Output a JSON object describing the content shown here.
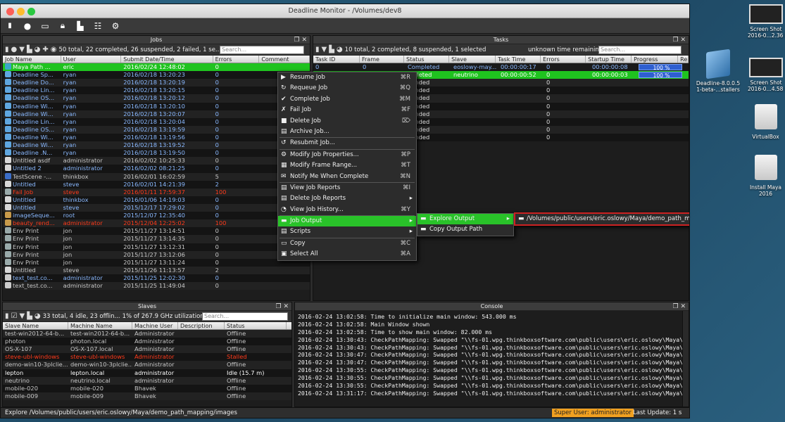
{
  "window": {
    "title": "Deadline Monitor - /Volumes/dev8"
  },
  "jobs_panel": {
    "title": "Jobs",
    "summary": "50 total, 22 completed, 26 suspended, 2 failed, 1 se...",
    "search_placeholder": "Search...",
    "columns": [
      "Job Name",
      "User",
      "Submit Date/Time",
      "Errors",
      "Comment"
    ],
    "rows": [
      {
        "name": "Maya Path ...",
        "user": "eric",
        "date": "2016/02/24 12:48:02",
        "errors": "0",
        "style": "sel",
        "icon": "maya-icon"
      },
      {
        "name": "Deadline Sp...",
        "user": "ryan",
        "date": "2016/02/18 13:20:23",
        "errors": "0",
        "style": "blue",
        "icon": "deadline-icon"
      },
      {
        "name": "Deadline Do...",
        "user": "ryan",
        "date": "2016/02/18 13:20:19",
        "errors": "0",
        "style": "blue",
        "icon": "deadline-icon"
      },
      {
        "name": "Deadline Lin...",
        "user": "ryan",
        "date": "2016/02/18 13:20:15",
        "errors": "0",
        "style": "blue",
        "icon": "deadline-icon"
      },
      {
        "name": "Deadline OS...",
        "user": "ryan",
        "date": "2016/02/18 13:20:12",
        "errors": "0",
        "style": "blue",
        "icon": "deadline-icon"
      },
      {
        "name": "Deadline Wi...",
        "user": "ryan",
        "date": "2016/02/18 13:20:10",
        "errors": "0",
        "style": "blue",
        "icon": "deadline-icon"
      },
      {
        "name": "Deadline Wi...",
        "user": "ryan",
        "date": "2016/02/18 13:20:07",
        "errors": "0",
        "style": "blue",
        "icon": "deadline-icon"
      },
      {
        "name": "Deadline Lin...",
        "user": "ryan",
        "date": "2016/02/18 13:20:04",
        "errors": "0",
        "style": "blue",
        "icon": "deadline-icon"
      },
      {
        "name": "Deadline OS...",
        "user": "ryan",
        "date": "2016/02/18 13:19:59",
        "errors": "0",
        "style": "blue",
        "icon": "deadline-icon"
      },
      {
        "name": "Deadline Wi...",
        "user": "ryan",
        "date": "2016/02/18 13:19:56",
        "errors": "0",
        "style": "blue",
        "icon": "deadline-icon"
      },
      {
        "name": "Deadline Wi...",
        "user": "ryan",
        "date": "2016/02/18 13:19:52",
        "errors": "0",
        "style": "blue",
        "icon": "deadline-icon"
      },
      {
        "name": "Deadline .N...",
        "user": "ryan",
        "date": "2016/02/18 13:19:50",
        "errors": "0",
        "style": "blue",
        "icon": "deadline-icon"
      },
      {
        "name": "Untitled asdf",
        "user": "administrator",
        "date": "2016/02/02 10:25:33",
        "errors": "0",
        "style": "gray",
        "icon": "window-icon"
      },
      {
        "name": "Untitled 2",
        "user": "administrator",
        "date": "2016/02/02 08:21:25",
        "errors": "0",
        "style": "blue",
        "icon": "window-icon"
      },
      {
        "name": "TestScene -...",
        "user": "thinkbox",
        "date": "2016/02/01 16:02:59",
        "errors": "5",
        "style": "gray",
        "icon": "3dsmax-icon"
      },
      {
        "name": "Untitled",
        "user": "steve",
        "date": "2016/02/01 14:21:39",
        "errors": "2",
        "style": "blue",
        "icon": "window-icon"
      },
      {
        "name": "Fail Job",
        "user": "steve",
        "date": "2016/01/11 17:59:37",
        "errors": "100",
        "style": "red",
        "icon": "script-icon"
      },
      {
        "name": "Untitled",
        "user": "thinkbox",
        "date": "2016/01/06 14:19:03",
        "errors": "0",
        "style": "blue",
        "icon": "window-icon"
      },
      {
        "name": "Untitled",
        "user": "steve",
        "date": "2015/12/17 17:29:02",
        "errors": "0",
        "style": "blue",
        "icon": "window-icon"
      },
      {
        "name": "imageSeque...",
        "user": "root",
        "date": "2015/12/07 12:35:40",
        "errors": "0",
        "style": "blue",
        "icon": "image-icon"
      },
      {
        "name": "beauty_rend...",
        "user": "administrator",
        "date": "2015/12/04 12:25:02",
        "errors": "100",
        "style": "red",
        "icon": "image-icon"
      },
      {
        "name": "Env Print",
        "user": "jon",
        "date": "2015/11/27 13:14:51",
        "errors": "0",
        "style": "gray",
        "icon": "script-icon"
      },
      {
        "name": "Env Print",
        "user": "jon",
        "date": "2015/11/27 13:14:35",
        "errors": "0",
        "style": "gray",
        "icon": "script-icon"
      },
      {
        "name": "Env Print",
        "user": "jon",
        "date": "2015/11/27 13:12:31",
        "errors": "0",
        "style": "gray",
        "icon": "script-icon"
      },
      {
        "name": "Env Print",
        "user": "jon",
        "date": "2015/11/27 13:12:06",
        "errors": "0",
        "style": "gray",
        "icon": "script-icon"
      },
      {
        "name": "Env Print",
        "user": "jon",
        "date": "2015/11/27 13:11:24",
        "errors": "0",
        "style": "gray",
        "icon": "script-icon"
      },
      {
        "name": "Untitled",
        "user": "steve",
        "date": "2015/11/26 11:13:57",
        "errors": "2",
        "style": "gray",
        "icon": "window-icon"
      },
      {
        "name": "text_test.co...",
        "user": "administrator",
        "date": "2015/11/25 12:02:30",
        "errors": "0",
        "style": "blue",
        "icon": "f-icon"
      },
      {
        "name": "text_test.co...",
        "user": "administrator",
        "date": "2015/11/25 11:49:04",
        "errors": "0",
        "style": "gray",
        "icon": "f-icon"
      }
    ]
  },
  "tasks_panel": {
    "title": "Tasks",
    "summary": "10 total, 2 completed, 8 suspended, 1 selected",
    "time_remaining": "unknown time remaining",
    "search_placeholder": "Search...",
    "columns": [
      "Task ID",
      "Frame",
      "Status",
      "Slave",
      "Task Time",
      "Errors",
      "Startup Time",
      "Progress",
      "Re"
    ],
    "rows": [
      {
        "id": "0",
        "frame": "0",
        "status": "Completed",
        "slave": "eoslowy-may...",
        "time": "00:00:00:17",
        "errors": "0",
        "startup": "00:00:00:08",
        "progress": "100 %",
        "style": "selblue"
      },
      {
        "id": "",
        "frame": "",
        "status": "mpleted",
        "slave": "neutrino",
        "time": "00:00:00:52",
        "errors": "0",
        "startup": "00:00:00:03",
        "progress": "100 %",
        "style": "sel"
      },
      {
        "id": "",
        "frame": "",
        "status": "pended",
        "slave": "",
        "time": "",
        "errors": "0",
        "startup": "",
        "progress": ""
      },
      {
        "id": "",
        "frame": "",
        "status": "pended",
        "slave": "",
        "time": "",
        "errors": "0",
        "startup": "",
        "progress": ""
      },
      {
        "id": "",
        "frame": "",
        "status": "pended",
        "slave": "",
        "time": "",
        "errors": "0",
        "startup": "",
        "progress": ""
      },
      {
        "id": "",
        "frame": "",
        "status": "pended",
        "slave": "",
        "time": "",
        "errors": "0",
        "startup": "",
        "progress": ""
      },
      {
        "id": "",
        "frame": "",
        "status": "pended",
        "slave": "",
        "time": "",
        "errors": "0",
        "startup": "",
        "progress": ""
      },
      {
        "id": "",
        "frame": "",
        "status": "pended",
        "slave": "",
        "time": "",
        "errors": "0",
        "startup": "",
        "progress": ""
      },
      {
        "id": "",
        "frame": "",
        "status": "pended",
        "slave": "",
        "time": "",
        "errors": "0",
        "startup": "",
        "progress": ""
      },
      {
        "id": "",
        "frame": "",
        "status": "pended",
        "slave": "",
        "time": "",
        "errors": "0",
        "startup": "",
        "progress": ""
      }
    ]
  },
  "context_menu": {
    "items": [
      {
        "label": "Resume Job",
        "shortcut": "⌘R",
        "icon": "resume-icon",
        "sep": false
      },
      {
        "label": "Requeue Job",
        "shortcut": "⌘Q",
        "icon": "requeue-icon",
        "sep": false
      },
      {
        "label": "Complete Job",
        "shortcut": "⌘M",
        "icon": "complete-icon",
        "sep": false
      },
      {
        "label": "Fail Job",
        "shortcut": "⌘F",
        "icon": "fail-icon",
        "sep": false
      },
      {
        "label": "Delete Job",
        "shortcut": "⌦",
        "icon": "delete-icon",
        "sep": false
      },
      {
        "label": "Archive Job...",
        "shortcut": "",
        "icon": "archive-icon",
        "sep": true
      },
      {
        "label": "Resubmit Job...",
        "shortcut": "",
        "icon": "resubmit-icon",
        "sep": true
      },
      {
        "label": "Modify Job Properties...",
        "shortcut": "⌘P",
        "icon": "gear-icon",
        "sep": false
      },
      {
        "label": "Modify Frame Range...",
        "shortcut": "⌘T",
        "icon": "frame-range-icon",
        "sep": false
      },
      {
        "label": "Notify Me When Complete",
        "shortcut": "⌘N",
        "icon": "mail-icon",
        "sep": true
      },
      {
        "label": "View Job Reports",
        "shortcut": "⌘I",
        "icon": "report-icon",
        "sep": false
      },
      {
        "label": "Delete Job Reports",
        "shortcut": "",
        "icon": "delete-reports-icon",
        "arrow": true,
        "sep": false
      },
      {
        "label": "View Job History...",
        "shortcut": "⌘Y",
        "icon": "history-icon",
        "sep": true
      },
      {
        "label": "Job Output",
        "shortcut": "",
        "icon": "folder-icon",
        "arrow": true,
        "active": true,
        "sep": false
      },
      {
        "label": "Scripts",
        "shortcut": "",
        "icon": "script-icon",
        "arrow": true,
        "sep": true
      },
      {
        "label": "Copy",
        "shortcut": "⌘C",
        "icon": "copy-icon",
        "sep": false
      },
      {
        "label": "Select All",
        "shortcut": "⌘A",
        "icon": "select-all-icon",
        "sep": false
      }
    ],
    "submenu": [
      {
        "label": "Explore Output",
        "active": true,
        "arrow": true
      },
      {
        "label": "Copy Output Path",
        "active": false,
        "arrow": false
      }
    ],
    "output_path": {
      "label": "/Volumes/public/users/eric.oslowy/Maya/demo_path_mapping/images",
      "shortcut": "⌘O"
    }
  },
  "slaves_panel": {
    "title": "Slaves",
    "summary": "33 total, 4 idle, 23 offlin...",
    "ghz": "1% of 267.9 GHz utilization",
    "search_placeholder": "Search...",
    "columns": [
      "Slave Name",
      "Machine Name",
      "Machine User",
      "Description",
      "Status"
    ],
    "rows": [
      {
        "name": "test-win2012-64-b...",
        "machine": "test-win2012-64-b...",
        "user": "Administrator",
        "desc": "",
        "status": "Offline",
        "style": "gray"
      },
      {
        "name": "photon",
        "machine": "photon.local",
        "user": "Administrator",
        "desc": "",
        "status": "Offline",
        "style": "gray"
      },
      {
        "name": "OS-X-107",
        "machine": "OS-X-107.local",
        "user": "Administrator",
        "desc": "",
        "status": "Offline",
        "style": "gray"
      },
      {
        "name": "steve-ubl-windows",
        "machine": "steve-ubl-windows",
        "user": "Administrator",
        "desc": "",
        "status": "Stalled",
        "style": "red"
      },
      {
        "name": "demo-win10-3plclie...",
        "machine": "demo-win10-3plclie...",
        "user": "Administrator",
        "desc": "",
        "status": "Offline",
        "style": "gray"
      },
      {
        "name": "lepton",
        "machine": "lepton.local",
        "user": "administrator",
        "desc": "",
        "status": "Idle (15.7 m)",
        "style": "white"
      },
      {
        "name": "neutrino",
        "machine": "neutrino.local",
        "user": "administrator",
        "desc": "",
        "status": "Offline",
        "style": "gray"
      },
      {
        "name": "mobile-020",
        "machine": "mobile-020",
        "user": "Bhavek",
        "desc": "",
        "status": "Offline",
        "style": "gray"
      },
      {
        "name": "mobile-009",
        "machine": "mobile-009",
        "user": "Bhavek",
        "desc": "",
        "status": "Offline",
        "style": "gray"
      }
    ]
  },
  "console_panel": {
    "title": "Console",
    "lines": [
      "2016-02-24 13:02:58:  Time to initialize main window: 543.000 ms",
      "2016-02-24 13:02:58:  Main Window shown",
      "2016-02-24 13:02:58:  Time to show main window: 82.000 ms",
      "2016-02-24 13:30:43:  CheckPathMapping: Swapped \"\\\\fs-01.wpg.thinkboxsoftware.com\\public\\users\\eric.oslowy\\Maya\\demo",
      "2016-02-24 13:30:43:  CheckPathMapping: Swapped \"\\\\fs-01.wpg.thinkboxsoftware.com\\public\\users\\eric.oslowy\\Maya\\demo",
      "2016-02-24 13:30:47:  CheckPathMapping: Swapped \"\\\\fs-01.wpg.thinkboxsoftware.com\\public\\users\\eric.oslowy\\Maya\\demo",
      "2016-02-24 13:30:47:  CheckPathMapping: Swapped \"\\\\fs-01.wpg.thinkboxsoftware.com\\public\\users\\eric.oslowy\\Maya\\demo",
      "2016-02-24 13:30:55:  CheckPathMapping: Swapped \"\\\\fs-01.wpg.thinkboxsoftware.com\\public\\users\\eric.oslowy\\Maya\\demo",
      "2016-02-24 13:30:55:  CheckPathMapping: Swapped \"\\\\fs-01.wpg.thinkboxsoftware.com\\public\\users\\eric.oslowy\\Maya\\demo",
      "2016-02-24 13:30:55:  CheckPathMapping: Swapped \"\\\\fs-01.wpg.thinkboxsoftware.com\\public\\users\\eric.oslowy\\Maya\\demo",
      "2016-02-24 13:31:17:  CheckPathMapping: Swapped \"\\\\fs-01.wpg.thinkboxsoftware.com\\public\\users\\eric.oslowy\\Maya\\demo"
    ]
  },
  "status_bar": {
    "left": "Explore /Volumes/public/users/eric.oslowy/Maya/demo_path_mapping/images",
    "super_user": "Super User: administrator",
    "last_update": "Last Update: 1 s"
  },
  "desktop": {
    "icons": [
      {
        "label": "Screen Shot\n2016-0...2.36 PM",
        "kind": "screenshot-icon"
      },
      {
        "label": "Deadline-8.0.0.5\n1-beta-...stallers",
        "kind": "deadline-icon"
      },
      {
        "label": "Screen Shot\n2016-0...4.58 PM",
        "kind": "screenshot-icon"
      },
      {
        "label": "VirtualBox",
        "kind": "drive-icon"
      },
      {
        "label": "Install Maya\n2016",
        "kind": "drive-icon"
      }
    ]
  },
  "colors": {
    "selected_green": "#1fc31f",
    "blue_text": "#8ab9ff",
    "red_text": "#ff3a1a",
    "progress_blue": "#2e5fd0"
  }
}
